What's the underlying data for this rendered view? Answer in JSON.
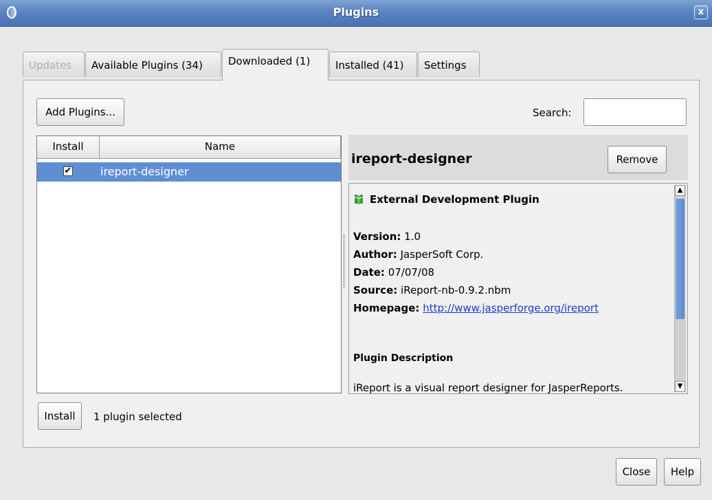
{
  "window": {
    "title": "Plugins",
    "close_glyph": "x",
    "icon": "app-shield-icon"
  },
  "tabs": [
    {
      "label": "Updates",
      "state": "disabled"
    },
    {
      "label": "Available Plugins (34)",
      "state": "normal"
    },
    {
      "label": "Downloaded (1)",
      "state": "active"
    },
    {
      "label": "Installed (41)",
      "state": "normal"
    },
    {
      "label": "Settings",
      "state": "normal"
    }
  ],
  "toolbar": {
    "add_plugins_label": "Add Plugins...",
    "search_label": "Search:",
    "search_value": ""
  },
  "table": {
    "columns": [
      "Install",
      "Name"
    ],
    "rows": [
      {
        "install_checked": true,
        "check_glyph": "✔",
        "name": "ireport-designer",
        "selected": true
      }
    ]
  },
  "detail": {
    "title": "ireport-designer",
    "remove_label": "Remove",
    "category_icon": "people-icon",
    "category": "External Development Plugin",
    "version_label": "Version:",
    "version": "1.0",
    "author_label": "Author:",
    "author": "JasperSoft Corp.",
    "date_label": "Date:",
    "date": "07/07/08",
    "source_label": "Source:",
    "source": "iReport-nb-0.9.2.nbm",
    "homepage_label": "Homepage:",
    "homepage": "http://www.jasperforge.org/ireport",
    "description_heading": "Plugin Description",
    "description": "iReport is a visual report designer for JasperReports."
  },
  "footer": {
    "install_label": "Install",
    "status": "1 plugin selected",
    "close_label": "Close",
    "help_label": "Help"
  },
  "colors": {
    "titlebar": "#5a83c0",
    "selection": "#5f8fd3",
    "link": "#1b3ec9",
    "scroll_thumb": "#6a96d4"
  }
}
